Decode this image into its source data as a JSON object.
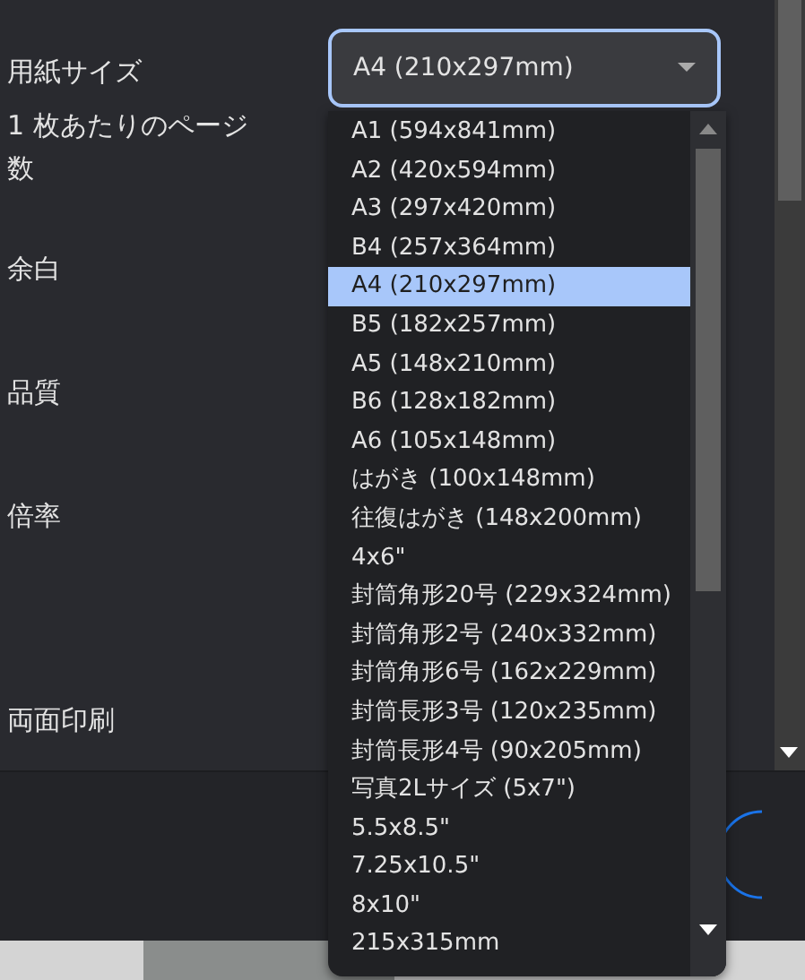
{
  "settings": [
    {
      "label": "用紙サイズ"
    },
    {
      "label": "1 枚あたりのページ数"
    },
    {
      "label": "余白"
    },
    {
      "label": "品質"
    },
    {
      "label": "倍率"
    },
    {
      "label": "両面印刷"
    }
  ],
  "paper_select": {
    "value": "A4 (210x297mm)",
    "expanded": true
  },
  "options": [
    {
      "label": "A1 (594x841mm)",
      "selected": false
    },
    {
      "label": "A2 (420x594mm)",
      "selected": false
    },
    {
      "label": "A3 (297x420mm)",
      "selected": false
    },
    {
      "label": "B4 (257x364mm)",
      "selected": false
    },
    {
      "label": "A4 (210x297mm)",
      "selected": true
    },
    {
      "label": "B5 (182x257mm)",
      "selected": false
    },
    {
      "label": "A5 (148x210mm)",
      "selected": false
    },
    {
      "label": "B6 (128x182mm)",
      "selected": false
    },
    {
      "label": "A6 (105x148mm)",
      "selected": false
    },
    {
      "label": "はがき (100x148mm)",
      "selected": false
    },
    {
      "label": "往復はがき (148x200mm)",
      "selected": false
    },
    {
      "label": "4x6\"",
      "selected": false
    },
    {
      "label": "封筒角形20号 (229x324mm)",
      "selected": false
    },
    {
      "label": "封筒角形2号 (240x332mm)",
      "selected": false
    },
    {
      "label": "封筒角形6号 (162x229mm)",
      "selected": false
    },
    {
      "label": "封筒長形3号 (120x235mm)",
      "selected": false
    },
    {
      "label": "封筒長形4号 (90x205mm)",
      "selected": false
    },
    {
      "label": "写真2Lサイズ (5x7\")",
      "selected": false
    },
    {
      "label": "5.5x8.5\"",
      "selected": false
    },
    {
      "label": "7.25x10.5\"",
      "selected": false
    },
    {
      "label": "8x10\"",
      "selected": false
    },
    {
      "label": "215x315mm",
      "selected": false
    }
  ]
}
